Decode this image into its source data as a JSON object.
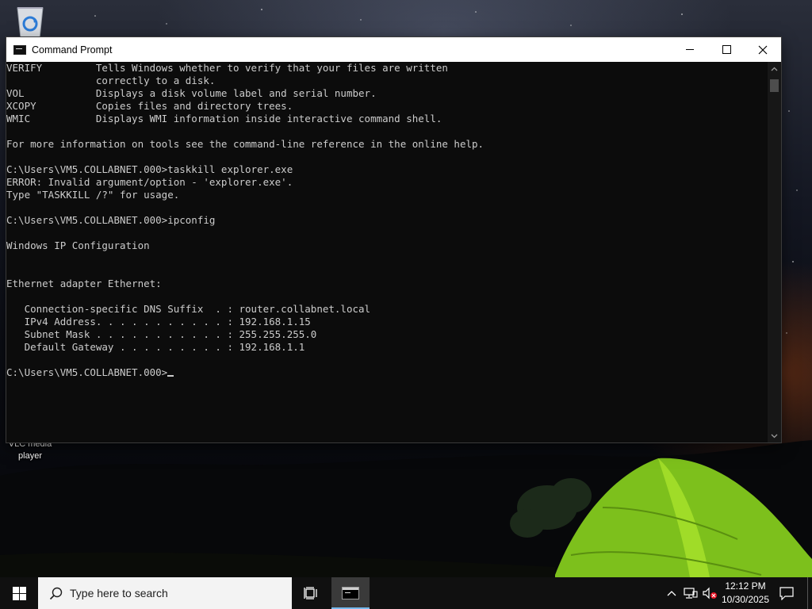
{
  "desktop": {
    "icons": [
      {
        "label": "",
        "icon": "recycle-bin-icon"
      },
      {
        "label": "VLC media player",
        "icon": "vlc-icon"
      }
    ]
  },
  "window": {
    "title": "Command Prompt",
    "buttons": {
      "minimize": "minimize",
      "maximize": "maximize",
      "close": "close"
    }
  },
  "console": {
    "lines": [
      "VERIFY         Tells Windows whether to verify that your files are written",
      "               correctly to a disk.",
      "VOL            Displays a disk volume label and serial number.",
      "XCOPY          Copies files and directory trees.",
      "WMIC           Displays WMI information inside interactive command shell.",
      "",
      "For more information on tools see the command-line reference in the online help.",
      "",
      "C:\\Users\\VM5.COLLABNET.000>taskkill explorer.exe",
      "ERROR: Invalid argument/option - 'explorer.exe'.",
      "Type \"TASKKILL /?\" for usage.",
      "",
      "C:\\Users\\VM5.COLLABNET.000>ipconfig",
      "",
      "Windows IP Configuration",
      "",
      "",
      "Ethernet adapter Ethernet:",
      "",
      "   Connection-specific DNS Suffix  . : router.collabnet.local",
      "   IPv4 Address. . . . . . . . . . . : 192.168.1.15",
      "   Subnet Mask . . . . . . . . . . . : 255.255.255.0",
      "   Default Gateway . . . . . . . . . : 192.168.1.1",
      ""
    ],
    "prompt": "C:\\Users\\VM5.COLLABNET.000>"
  },
  "taskbar": {
    "search_placeholder": "Type here to search",
    "time": "12:12 PM",
    "date": "10/30/2025",
    "accent_color": "#76b9ed"
  }
}
